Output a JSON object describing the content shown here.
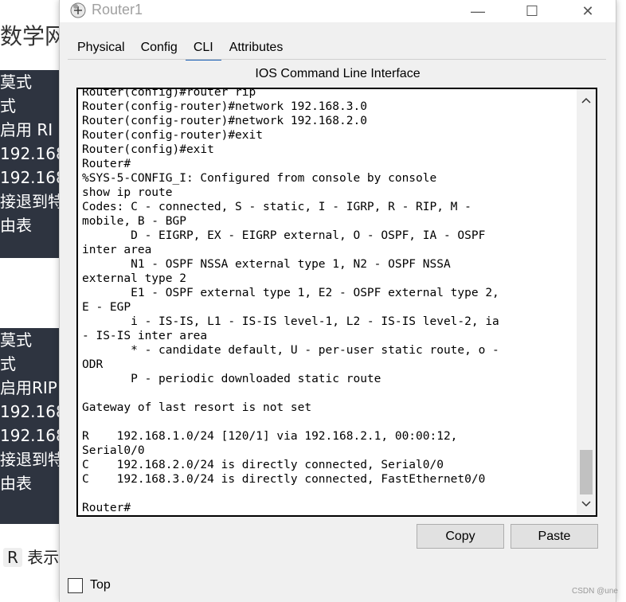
{
  "background_page": {
    "title": "数学网",
    "block1_lines": [
      "莫式",
      "式",
      "启用 RI",
      "192.168",
      "192.168",
      "接退到特",
      "由表"
    ],
    "block2_lines": [
      "莫式",
      "式",
      "启用RIP",
      "192.168",
      "192.168",
      "接退到特",
      "由表"
    ],
    "footer_badge": "R",
    "footer_text": "表示"
  },
  "window": {
    "title": "Router1",
    "minimize_glyph": "—",
    "maximize_glyph": "☐",
    "close_glyph": "✕"
  },
  "tabs": [
    {
      "label": "Physical"
    },
    {
      "label": "Config"
    },
    {
      "label": "CLI"
    },
    {
      "label": "Attributes"
    }
  ],
  "cli": {
    "heading": "IOS Command Line Interface",
    "output": "Router(config)#router rip\nRouter(config-router)#network 192.168.3.0\nRouter(config-router)#network 192.168.2.0\nRouter(config-router)#exit\nRouter(config)#exit\nRouter#\n%SYS-5-CONFIG_I: Configured from console by console\nshow ip route\nCodes: C - connected, S - static, I - IGRP, R - RIP, M -\nmobile, B - BGP\n       D - EIGRP, EX - EIGRP external, O - OSPF, IA - OSPF\ninter area\n       N1 - OSPF NSSA external type 1, N2 - OSPF NSSA\nexternal type 2\n       E1 - OSPF external type 1, E2 - OSPF external type 2,\nE - EGP\n       i - IS-IS, L1 - IS-IS level-1, L2 - IS-IS level-2, ia\n- IS-IS inter area\n       * - candidate default, U - per-user static route, o -\nODR\n       P - periodic downloaded static route\n\nGateway of last resort is not set\n\nR    192.168.1.0/24 [120/1] via 192.168.2.1, 00:00:12,\nSerial0/0\nC    192.168.2.0/24 is directly connected, Serial0/0\nC    192.168.3.0/24 is directly connected, FastEthernet0/0\n\nRouter#"
  },
  "buttons": {
    "copy": "Copy",
    "paste": "Paste"
  },
  "top_checkbox": {
    "label": "Top",
    "checked": false
  },
  "watermark": "CSDN @une",
  "colors": {
    "active_tab_underline": "#1a5fb4",
    "bg_block": "#2e3440"
  }
}
